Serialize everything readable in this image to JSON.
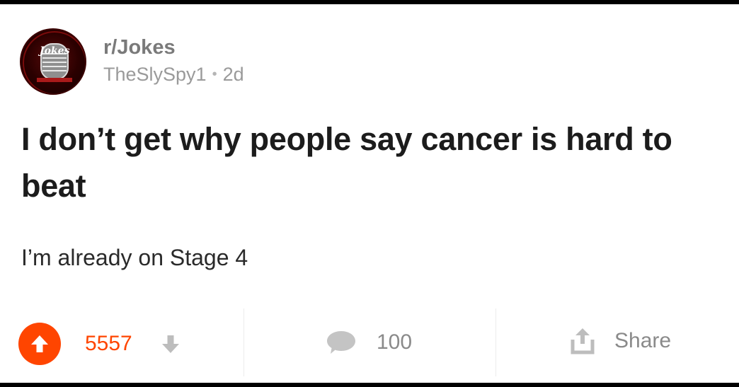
{
  "post": {
    "subreddit": "r/Jokes",
    "author": "TheSlySpy1",
    "separator": "•",
    "age": "2d",
    "avatar_text": "Jokes",
    "title": "I don’t get why people say cancer is hard to beat",
    "body": "I’m already on Stage 4"
  },
  "actions": {
    "score": "5557",
    "comments": "100",
    "share_label": "Share"
  },
  "icons": {
    "upvote": "upvote-arrow-icon",
    "downvote": "downvote-arrow-icon",
    "comment": "comment-bubble-icon",
    "share": "share-icon",
    "avatar": "microphone-icon"
  },
  "colors": {
    "accent": "#ff4500",
    "muted": "#8a8a8a",
    "title": "#1c1c1c"
  }
}
